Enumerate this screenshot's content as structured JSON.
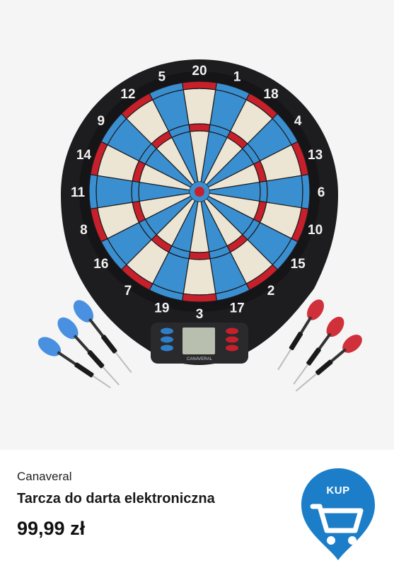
{
  "board": {
    "numbers": [
      "20",
      "1",
      "18",
      "4",
      "13",
      "6",
      "10",
      "15",
      "2",
      "17",
      "3",
      "19",
      "7",
      "16",
      "8",
      "11",
      "14",
      "9",
      "12",
      "5"
    ],
    "display_brand": "CANAVERAL"
  },
  "product": {
    "brand": "Canaveral",
    "title": "Tarcza do darta elektroniczna",
    "price": "99,99 zł"
  },
  "buy_button": {
    "label": "KUP",
    "icon": "cart-icon"
  },
  "colors": {
    "board_blue": "#3a8fd0",
    "board_cream": "#ece5d4",
    "board_red": "#c8202b",
    "accent_blue": "#1c7ec9",
    "dart_blue": "#4a90e0",
    "dart_red": "#d0303a"
  }
}
